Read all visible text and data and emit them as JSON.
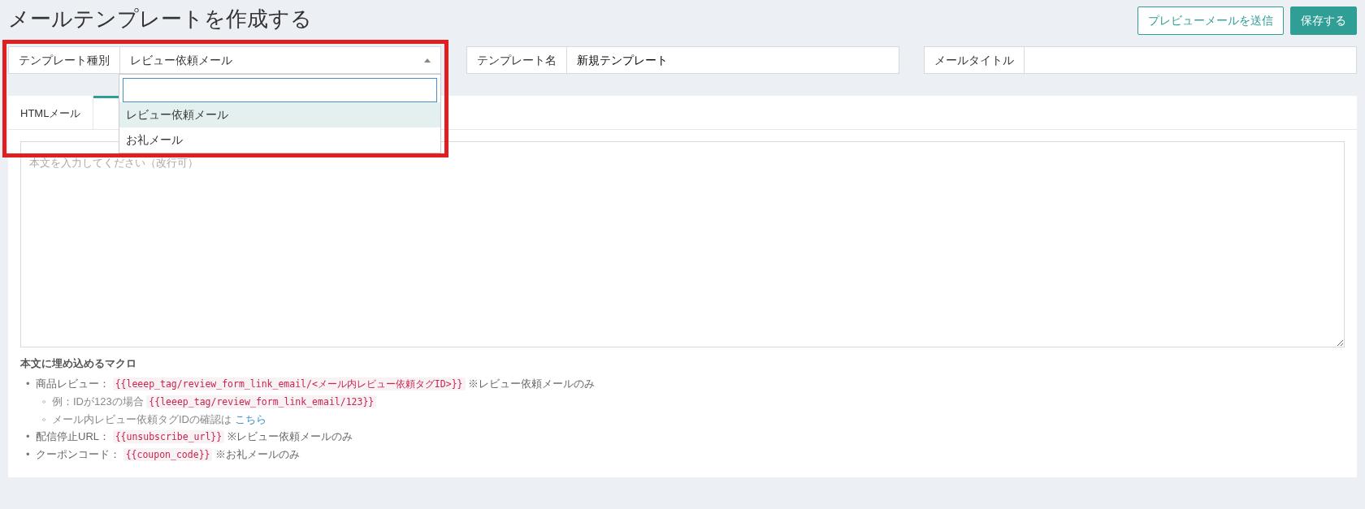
{
  "page_title": "メールテンプレートを作成する",
  "buttons": [
    {
      "label": "プレビューメールを送信",
      "kind": "outline"
    },
    {
      "label": "保存する",
      "kind": "primary"
    }
  ],
  "fields": [
    {
      "label": "テンプレート種別",
      "value": "レビュー依頼メール",
      "kind": "select",
      "expanded": true,
      "highlighted": true,
      "options": [
        {
          "label": "レビュー依頼メール",
          "selected": true
        },
        {
          "label": "お礼メール",
          "selected": false
        }
      ]
    },
    {
      "label": "テンプレート名",
      "value": "新規テンプレート",
      "kind": "text"
    },
    {
      "label": "メールタイトル",
      "kind": "text"
    }
  ],
  "tabs": [
    {
      "label": "HTMLメール",
      "selected": false
    },
    {
      "selected": true
    }
  ],
  "body": {
    "placeholder": "本文を入力してください（改行可）"
  },
  "macros": {
    "heading": "本文に埋め込めるマクロ",
    "items": [
      {
        "marker": "•",
        "text": "商品レビュー：",
        "code": "{{leeep_tag/review_form_link_email/<メール内レビュー依頼タグID>}}",
        "note": "※レビュー依頼メールのみ",
        "children": [
          {
            "marker": "◦",
            "text": "例：IDが123の場合",
            "code": "{{leeep_tag/review_form_link_email/123}}"
          },
          {
            "marker": "◦",
            "text": "メール内レビュー依頼タグIDの確認は",
            "link": "こちら"
          }
        ]
      },
      {
        "marker": "•",
        "text": "配信停止URL：",
        "code": "{{unsubscribe_url}}",
        "note": "※レビュー依頼メールのみ"
      },
      {
        "marker": "•",
        "text": "クーポンコード：",
        "code": "{{coupon_code}}",
        "note": "※お礼メールのみ"
      }
    ]
  }
}
